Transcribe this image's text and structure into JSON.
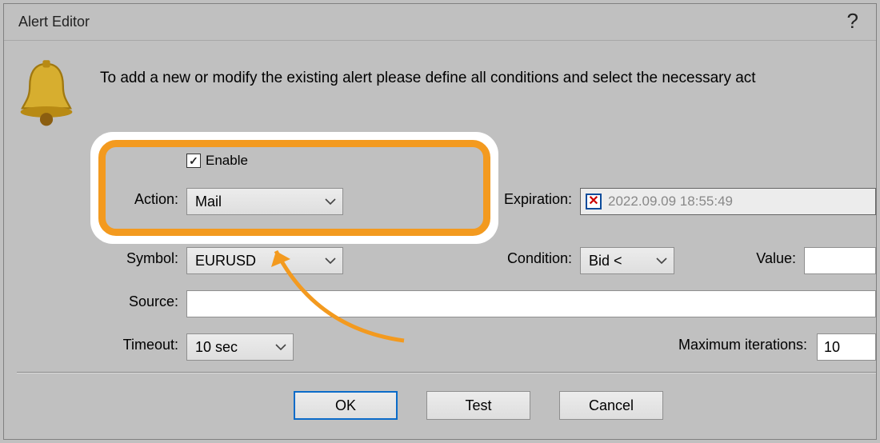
{
  "window": {
    "title": "Alert Editor",
    "help_glyph": "?"
  },
  "instruction": "To add a new or modify the existing alert please define all conditions and select the necessary act",
  "enable": {
    "label": "Enable",
    "checked": true
  },
  "action": {
    "label": "Action:",
    "value": "Mail"
  },
  "symbol": {
    "label": "Symbol:",
    "value": "EURUSD"
  },
  "source": {
    "label": "Source:",
    "value": ""
  },
  "timeout": {
    "label": "Timeout:",
    "value": "10 sec"
  },
  "expiration": {
    "label": "Expiration:",
    "value": "2022.09.09 18:55:49"
  },
  "condition": {
    "label": "Condition:",
    "value": "Bid <"
  },
  "value_field": {
    "label": "Value:",
    "value": ""
  },
  "max_iter": {
    "label": "Maximum iterations:",
    "value": "10"
  },
  "buttons": {
    "ok": "OK",
    "test": "Test",
    "cancel": "Cancel"
  },
  "icons": {
    "bell": "bell-icon",
    "chevron": "chevron-down-icon",
    "x": "✕"
  }
}
